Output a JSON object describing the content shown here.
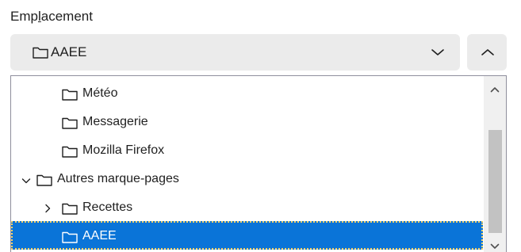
{
  "location": {
    "label_before": "Emp",
    "label_accesskey": "l",
    "label_after": "acement",
    "selected_value": "AAEE",
    "dropdown_icon": "chevron-down-icon",
    "collapse_icon": "chevron-up-icon"
  },
  "tree": {
    "items": [
      {
        "label": "Météo",
        "twisty": "none"
      },
      {
        "label": "Messagerie",
        "twisty": "none"
      },
      {
        "label": "Mozilla Firefox",
        "twisty": "none"
      },
      {
        "label": "Autres marque-pages",
        "twisty": "expanded"
      },
      {
        "label": "Recettes",
        "twisty": "collapsed"
      },
      {
        "label": "AAEE",
        "twisty": "none",
        "selected": true
      }
    ]
  },
  "colors": {
    "selection": "#0a74d8",
    "focus_ring": "#f5d36b",
    "button_bg": "#ebebeb"
  }
}
